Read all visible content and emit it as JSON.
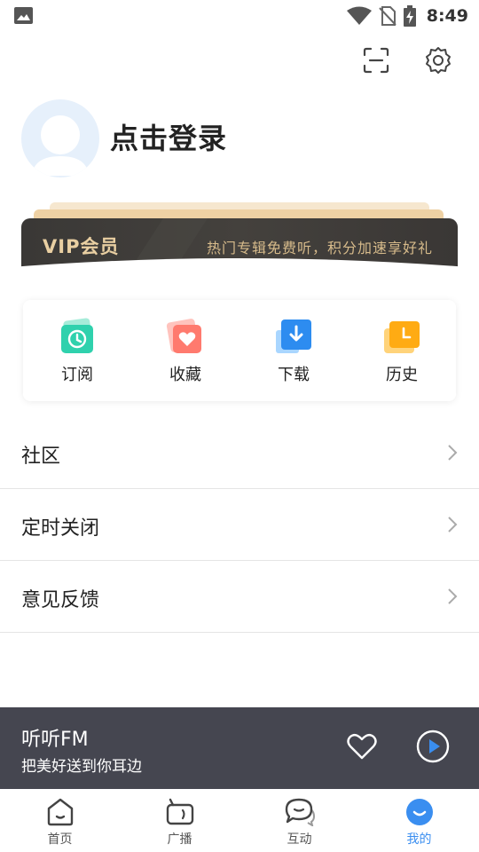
{
  "status_bar": {
    "time": "8:49"
  },
  "header": {
    "scan_icon": "scan-icon",
    "settings_icon": "gear-icon"
  },
  "profile": {
    "login_label": "点击登录"
  },
  "vip": {
    "title": "VIP会员",
    "description": "热门专辑免费听，积分加速享好礼"
  },
  "shortcuts": [
    {
      "label": "订阅",
      "icon": "subscribe-icon"
    },
    {
      "label": "收藏",
      "icon": "favorite-icon"
    },
    {
      "label": "下载",
      "icon": "download-icon"
    },
    {
      "label": "历史",
      "icon": "history-icon"
    }
  ],
  "menu": [
    {
      "label": "社区"
    },
    {
      "label": "定时关闭"
    },
    {
      "label": "意见反馈"
    }
  ],
  "player": {
    "station_name": "听听FM",
    "tagline": "把美好送到你耳边"
  },
  "tabs": [
    {
      "label": "首页"
    },
    {
      "label": "广播"
    },
    {
      "label": "互动"
    },
    {
      "label": "我的"
    }
  ],
  "colors": {
    "accent": "#3a8ef0",
    "player_bg": "#454650",
    "vip_gold": "#e9cfa2"
  }
}
